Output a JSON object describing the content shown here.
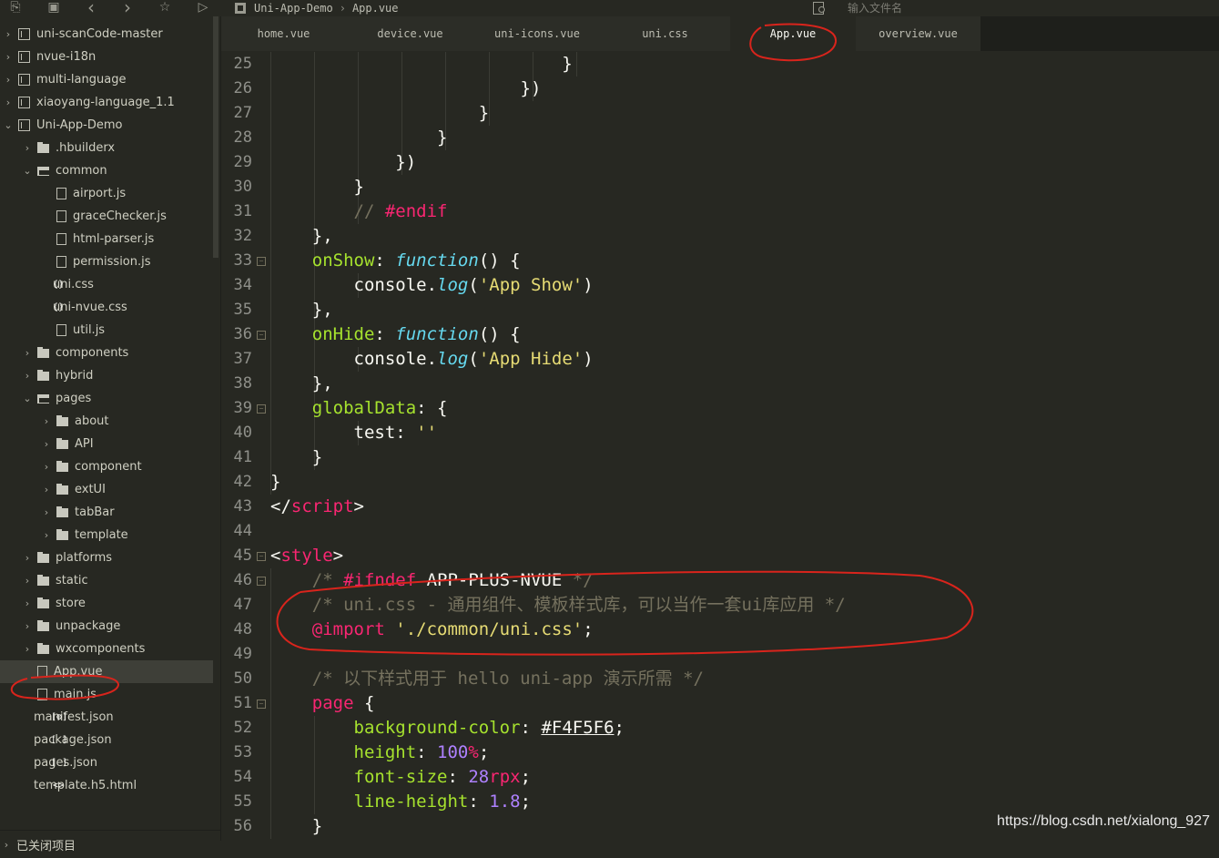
{
  "toolbar": {
    "icons": [
      "new-file-icon",
      "save-icon",
      "back-icon",
      "forward-icon",
      "star-icon",
      "run-icon"
    ],
    "glyphs": [
      "⎘",
      "▣",
      "‹",
      "›",
      "☆",
      "▷"
    ]
  },
  "breadcrumb": {
    "project": "Uni-App-Demo",
    "separator": "›",
    "file": "App.vue"
  },
  "search": {
    "placeholder": "输入文件名"
  },
  "sidebar": {
    "items": [
      {
        "label": "uni-scanCode-master",
        "type": "project",
        "arrow": "›",
        "depth": 0
      },
      {
        "label": "nvue-i18n",
        "type": "project",
        "arrow": "›",
        "depth": 0
      },
      {
        "label": "multi-language",
        "type": "project",
        "arrow": "›",
        "depth": 0
      },
      {
        "label": "xiaoyang-language_1.1",
        "type": "project",
        "arrow": "›",
        "depth": 0
      },
      {
        "label": "Uni-App-Demo",
        "type": "project",
        "arrow": "⌄",
        "depth": 0
      },
      {
        "label": ".hbuilderx",
        "type": "folder",
        "arrow": "›",
        "depth": 1
      },
      {
        "label": "common",
        "type": "folder-open",
        "arrow": "⌄",
        "depth": 1
      },
      {
        "label": "airport.js",
        "type": "file",
        "arrow": "",
        "depth": 2
      },
      {
        "label": "graceChecker.js",
        "type": "file",
        "arrow": "",
        "depth": 2
      },
      {
        "label": "html-parser.js",
        "type": "file",
        "arrow": "",
        "depth": 2
      },
      {
        "label": "permission.js",
        "type": "file",
        "arrow": "",
        "depth": 2
      },
      {
        "label": "uni.css",
        "type": "code",
        "glyph": "{}",
        "arrow": "",
        "depth": 2
      },
      {
        "label": "uni-nvue.css",
        "type": "code",
        "glyph": "{}",
        "arrow": "",
        "depth": 2
      },
      {
        "label": "util.js",
        "type": "file",
        "arrow": "",
        "depth": 2
      },
      {
        "label": "components",
        "type": "folder",
        "arrow": "›",
        "depth": 1
      },
      {
        "label": "hybrid",
        "type": "folder",
        "arrow": "›",
        "depth": 1
      },
      {
        "label": "pages",
        "type": "folder-open",
        "arrow": "⌄",
        "depth": 1
      },
      {
        "label": "about",
        "type": "folder",
        "arrow": "›",
        "depth": 2
      },
      {
        "label": "API",
        "type": "folder",
        "arrow": "›",
        "depth": 2
      },
      {
        "label": "component",
        "type": "folder",
        "arrow": "›",
        "depth": 2
      },
      {
        "label": "extUI",
        "type": "folder",
        "arrow": "›",
        "depth": 2
      },
      {
        "label": "tabBar",
        "type": "folder",
        "arrow": "›",
        "depth": 2
      },
      {
        "label": "template",
        "type": "folder",
        "arrow": "›",
        "depth": 2
      },
      {
        "label": "platforms",
        "type": "folder",
        "arrow": "›",
        "depth": 1
      },
      {
        "label": "static",
        "type": "folder",
        "arrow": "›",
        "depth": 1
      },
      {
        "label": "store",
        "type": "folder",
        "arrow": "›",
        "depth": 1
      },
      {
        "label": "unpackage",
        "type": "folder",
        "arrow": "›",
        "depth": 1
      },
      {
        "label": "wxcomponents",
        "type": "folder",
        "arrow": "›",
        "depth": 1
      },
      {
        "label": "App.vue",
        "type": "file",
        "arrow": "",
        "depth": 1,
        "selected": true
      },
      {
        "label": "main.js",
        "type": "file",
        "arrow": "",
        "depth": 1
      },
      {
        "label": "manifest.json",
        "type": "code",
        "glyph": "[⚙]",
        "arrow": "",
        "depth": 1
      },
      {
        "label": "package.json",
        "type": "code",
        "glyph": "[ ]",
        "arrow": "",
        "depth": 1
      },
      {
        "label": "pages.json",
        "type": "code",
        "glyph": "[ ]",
        "arrow": "",
        "depth": 1
      },
      {
        "label": "template.h5.html",
        "type": "code",
        "glyph": "<>",
        "arrow": "",
        "depth": 1
      }
    ],
    "footer": {
      "arrow": "›",
      "label": "已关闭项目"
    }
  },
  "tabs": [
    {
      "label": "home.vue",
      "active": false
    },
    {
      "label": "device.vue",
      "active": false
    },
    {
      "label": "uni-icons.vue",
      "active": false
    },
    {
      "label": "uni.css",
      "active": false
    },
    {
      "label": "App.vue",
      "active": true
    },
    {
      "label": "overview.vue",
      "active": false
    }
  ],
  "editor": {
    "lines": [
      {
        "n": "25",
        "fold": false,
        "guides": 8,
        "tokens": [
          [
            "",
            "                            }"
          ]
        ]
      },
      {
        "n": "26",
        "fold": false,
        "guides": 7,
        "tokens": [
          [
            "",
            "                        })"
          ]
        ]
      },
      {
        "n": "27",
        "fold": false,
        "guides": 6,
        "tokens": [
          [
            "",
            "                    }"
          ]
        ]
      },
      {
        "n": "28",
        "fold": false,
        "guides": 5,
        "tokens": [
          [
            "",
            "                }"
          ]
        ]
      },
      {
        "n": "29",
        "fold": false,
        "guides": 4,
        "tokens": [
          [
            "",
            "            })"
          ]
        ]
      },
      {
        "n": "30",
        "fold": false,
        "guides": 3,
        "tokens": [
          [
            "",
            "        }"
          ]
        ]
      },
      {
        "n": "31",
        "fold": false,
        "guides": 3,
        "tokens": [
          [
            "cm",
            "        // "
          ],
          [
            "kw",
            "#endif"
          ]
        ]
      },
      {
        "n": "32",
        "fold": false,
        "guides": 2,
        "tokens": [
          [
            "",
            "    },"
          ]
        ]
      },
      {
        "n": "33",
        "fold": true,
        "guides": 2,
        "tokens": [
          [
            "",
            "    "
          ],
          [
            "fn",
            "onShow"
          ],
          [
            "",
            ": "
          ],
          [
            "it",
            "function"
          ],
          [
            "",
            "() {"
          ]
        ]
      },
      {
        "n": "34",
        "fold": false,
        "guides": 3,
        "tokens": [
          [
            "",
            "        console."
          ],
          [
            "it",
            "log"
          ],
          [
            "",
            "("
          ],
          [
            "st",
            "'App Show'"
          ],
          [
            "",
            ")"
          ]
        ]
      },
      {
        "n": "35",
        "fold": false,
        "guides": 2,
        "tokens": [
          [
            "",
            "    },"
          ]
        ]
      },
      {
        "n": "36",
        "fold": true,
        "guides": 2,
        "tokens": [
          [
            "",
            "    "
          ],
          [
            "fn",
            "onHide"
          ],
          [
            "",
            ": "
          ],
          [
            "it",
            "function"
          ],
          [
            "",
            "() {"
          ]
        ]
      },
      {
        "n": "37",
        "fold": false,
        "guides": 3,
        "tokens": [
          [
            "",
            "        console."
          ],
          [
            "it",
            "log"
          ],
          [
            "",
            "("
          ],
          [
            "st",
            "'App Hide'"
          ],
          [
            "",
            ")"
          ]
        ]
      },
      {
        "n": "38",
        "fold": false,
        "guides": 2,
        "tokens": [
          [
            "",
            "    },"
          ]
        ]
      },
      {
        "n": "39",
        "fold": true,
        "guides": 2,
        "tokens": [
          [
            "",
            "    "
          ],
          [
            "fn",
            "globalData"
          ],
          [
            "",
            ": {"
          ]
        ]
      },
      {
        "n": "40",
        "fold": false,
        "guides": 3,
        "tokens": [
          [
            "",
            "        test: "
          ],
          [
            "st",
            "''"
          ]
        ]
      },
      {
        "n": "41",
        "fold": false,
        "guides": 2,
        "tokens": [
          [
            "",
            "    }"
          ]
        ]
      },
      {
        "n": "42",
        "fold": false,
        "guides": 1,
        "tokens": [
          [
            "",
            "}"
          ]
        ]
      },
      {
        "n": "43",
        "fold": false,
        "guides": 0,
        "tokens": [
          [
            "",
            "</"
          ],
          [
            "tg",
            "script"
          ],
          [
            "",
            ">"
          ]
        ]
      },
      {
        "n": "44",
        "fold": false,
        "guides": 0,
        "tokens": [
          [
            "",
            ""
          ]
        ]
      },
      {
        "n": "45",
        "fold": true,
        "guides": 0,
        "tokens": [
          [
            "",
            "<"
          ],
          [
            "tg",
            "style"
          ],
          [
            "",
            ">"
          ]
        ]
      },
      {
        "n": "46",
        "fold": true,
        "guides": 1,
        "tokens": [
          [
            "cm",
            "    /* "
          ],
          [
            "kw",
            "#ifndef"
          ],
          [
            "",
            " APP-PLUS-NVUE "
          ],
          [
            "cm",
            "*/"
          ]
        ]
      },
      {
        "n": "47",
        "fold": false,
        "guides": 1,
        "tokens": [
          [
            "cm",
            "    /* uni.css - 通用组件、模板样式库，可以当作一套ui库应用 */"
          ]
        ]
      },
      {
        "n": "48",
        "fold": false,
        "guides": 1,
        "tokens": [
          [
            "",
            "    "
          ],
          [
            "kw",
            "@import"
          ],
          [
            "",
            " "
          ],
          [
            "st",
            "'./common/uni.css'"
          ],
          [
            "",
            ";"
          ]
        ]
      },
      {
        "n": "49",
        "fold": false,
        "guides": 1,
        "tokens": [
          [
            "",
            ""
          ]
        ]
      },
      {
        "n": "50",
        "fold": false,
        "guides": 1,
        "tokens": [
          [
            "cm",
            "    /* 以下样式用于 hello uni-app 演示所需 */"
          ]
        ]
      },
      {
        "n": "51",
        "fold": true,
        "guides": 1,
        "tokens": [
          [
            "",
            "    "
          ],
          [
            "kw",
            "page"
          ],
          [
            "",
            " {"
          ]
        ]
      },
      {
        "n": "52",
        "fold": false,
        "guides": 2,
        "tokens": [
          [
            "",
            "        "
          ],
          [
            "fn",
            "background-color"
          ],
          [
            "",
            ": "
          ],
          [
            "ul",
            "#F4F5F6"
          ],
          [
            "",
            ";"
          ]
        ]
      },
      {
        "n": "53",
        "fold": false,
        "guides": 2,
        "tokens": [
          [
            "",
            "        "
          ],
          [
            "fn",
            "height"
          ],
          [
            "",
            ": "
          ],
          [
            "nu",
            "100"
          ],
          [
            "kw",
            "%"
          ],
          [
            "",
            ";"
          ]
        ]
      },
      {
        "n": "54",
        "fold": false,
        "guides": 2,
        "tokens": [
          [
            "",
            "        "
          ],
          [
            "fn",
            "font-size"
          ],
          [
            "",
            ": "
          ],
          [
            "nu",
            "28"
          ],
          [
            "kw",
            "rpx"
          ],
          [
            "",
            ";"
          ]
        ]
      },
      {
        "n": "55",
        "fold": false,
        "guides": 2,
        "tokens": [
          [
            "",
            "        "
          ],
          [
            "fn",
            "line-height"
          ],
          [
            "",
            ": "
          ],
          [
            "nu",
            "1.8"
          ],
          [
            "",
            ";"
          ]
        ]
      },
      {
        "n": "56",
        "fold": false,
        "guides": 1,
        "tokens": [
          [
            "",
            "    }"
          ]
        ]
      }
    ]
  },
  "watermark": "https://blog.csdn.net/xialong_927",
  "annotations": {
    "color": "#d9241c"
  }
}
